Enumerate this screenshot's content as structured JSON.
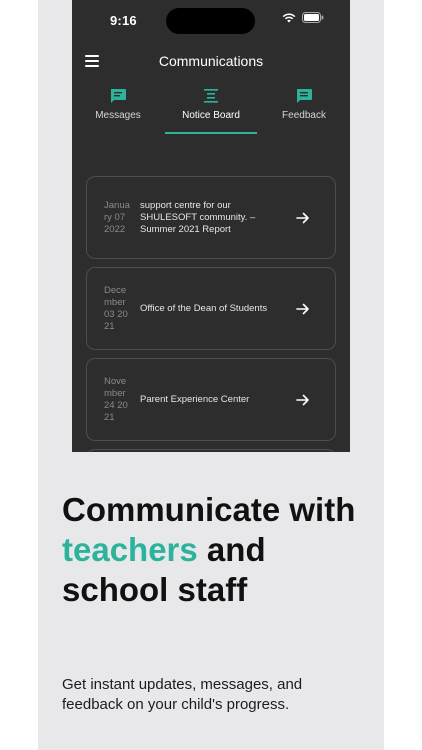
{
  "status_bar": {
    "time": "9:16"
  },
  "header": {
    "title": "Communications",
    "menu_icon": "menu-icon"
  },
  "tabs": [
    {
      "label": "Messages",
      "icon": "message-icon",
      "active": false
    },
    {
      "label": "Notice Board",
      "icon": "notice-board-icon",
      "active": true
    },
    {
      "label": "Feedback",
      "icon": "feedback-icon",
      "active": false
    }
  ],
  "notices": [
    {
      "date": "January 07 2022",
      "date_display": "Janua ry 07 2022",
      "title": "support centre for our SHULESOFT community. – Summer 2021 Report"
    },
    {
      "date": "December 03 2021",
      "date_display": "Dece mber 03 2021",
      "title": "Office of the Dean of Students"
    },
    {
      "date": "November 24 2021",
      "date_display": "Nove mber 24 2021",
      "title": "Parent Experience Center"
    }
  ],
  "promo": {
    "headline_part1": "Communicate with ",
    "headline_accent": "teachers",
    "headline_part2": " and school staff",
    "subtext": "Get instant updates, messages, and feedback on your child's progress."
  },
  "colors": {
    "accent": "#2bb39b",
    "app_background": "#2d2d2d",
    "panel_background": "#e8e8eb"
  }
}
